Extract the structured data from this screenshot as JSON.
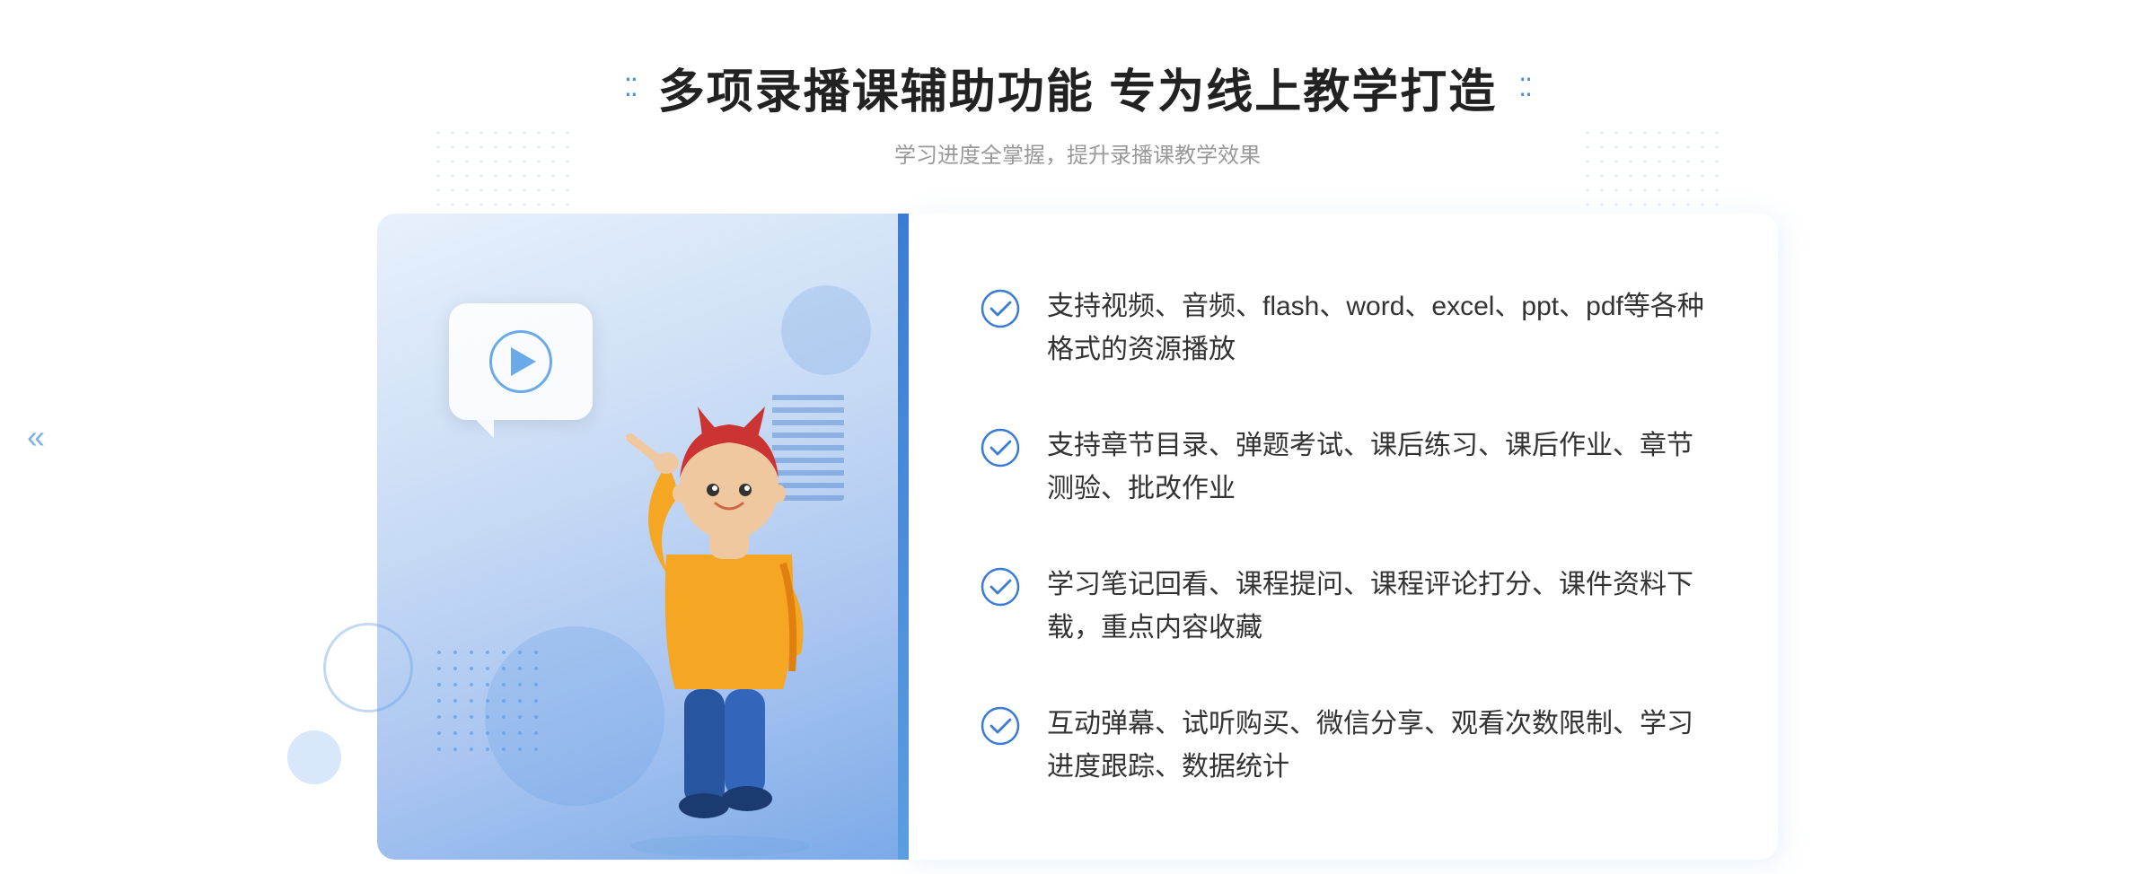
{
  "header": {
    "title": "多项录播课辅助功能 专为线上教学打造",
    "subtitle": "学习进度全掌握，提升录播课教学效果",
    "dots_left": "⁚⁚",
    "dots_right": "⁚⁚"
  },
  "features": [
    {
      "id": 1,
      "text": "支持视频、音频、flash、word、excel、ppt、pdf等各种格式的资源播放"
    },
    {
      "id": 2,
      "text": "支持章节目录、弹题考试、课后练习、课后作业、章节测验、批改作业"
    },
    {
      "id": 3,
      "text": "学习笔记回看、课程提问、课程评论打分、课件资料下载，重点内容收藏"
    },
    {
      "id": 4,
      "text": "互动弹幕、试听购买、微信分享、观看次数限制、学习进度跟踪、数据统计"
    }
  ],
  "icons": {
    "check": "check-circle",
    "play": "play-icon",
    "left_arrow": "«"
  },
  "colors": {
    "accent_blue": "#3a7bd5",
    "light_blue": "#6baae8",
    "text_dark": "#222222",
    "text_gray": "#999999",
    "text_body": "#333333"
  }
}
